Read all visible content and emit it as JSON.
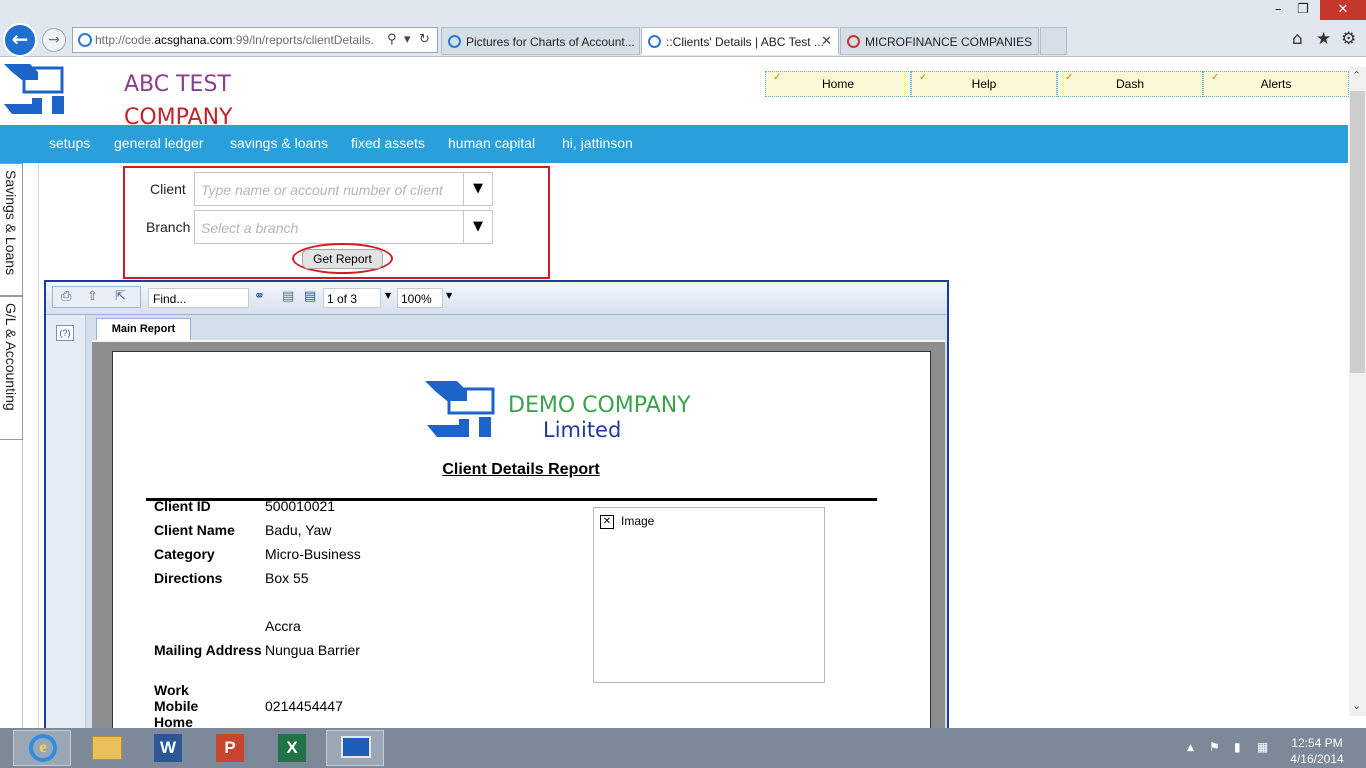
{
  "browser": {
    "address": {
      "prefix": "http://code.",
      "host": "acsghana.com",
      "rest": ":99/ln/reports/clientDetails."
    },
    "tabs": [
      {
        "label": "Pictures for Charts of Account..."
      },
      {
        "label": "::Clients' Details | ABC Test ..."
      },
      {
        "label": "MICROFINANCE COMPANIES"
      }
    ]
  },
  "header": {
    "company_line1": "ABC TEST",
    "company_line2": "COMPANY"
  },
  "topnav": [
    {
      "label": "Home"
    },
    {
      "label": "Help"
    },
    {
      "label": "Dash"
    },
    {
      "label": "Alerts"
    }
  ],
  "menu": [
    {
      "label": "setups"
    },
    {
      "label": "general ledger"
    },
    {
      "label": "savings & loans"
    },
    {
      "label": "fixed assets"
    },
    {
      "label": "human capital"
    },
    {
      "label": "hi, jattinson"
    }
  ],
  "side_tabs": [
    {
      "label": "Savings & Loans"
    },
    {
      "label": "G/L & Accounting"
    }
  ],
  "filter": {
    "client_label": "Client",
    "client_placeholder": "Type name or account number of client",
    "branch_label": "Branch",
    "branch_placeholder": "Select a branch",
    "button_label": "Get Report"
  },
  "viewer": {
    "find_placeholder": "Find...",
    "page_indicator": "1 of 3",
    "zoom": "100%",
    "tab_label": "Main Report",
    "help_label": "(?)"
  },
  "report": {
    "company_name": "DEMO COMPANY",
    "company_suffix": "Limited",
    "title": "Client Details Report",
    "image_caption": "Image",
    "fields": {
      "client_id": {
        "label": "Client ID",
        "value": "500010021"
      },
      "client_name": {
        "label": "Client Name",
        "value": "Badu, Yaw"
      },
      "category": {
        "label": "Category",
        "value": "Micro-Business"
      },
      "directions": {
        "label": "Directions",
        "value": "Box 55",
        "value2": "Accra"
      },
      "mailing": {
        "label": "Mailing Address",
        "value": "Nungua Barrier"
      },
      "work": {
        "label": "Work"
      },
      "mobile": {
        "label": "Mobile",
        "value": "0214454447"
      },
      "home": {
        "label": "Home"
      }
    }
  },
  "taskbar": {
    "time": "12:54 PM",
    "date": "4/16/2014"
  },
  "colors": {
    "menu_bar": "#29a0d9",
    "company_line1": "#8b3d8e",
    "company_line2": "#c0232c",
    "highlight_red": "#d21d23",
    "viewer_border": "#1b3ba3"
  },
  "icons": [
    "back-icon",
    "forward-icon",
    "search-icon",
    "refresh-icon",
    "home-icon",
    "star-icon",
    "gear-icon",
    "print-icon",
    "export-icon",
    "binoculars-icon",
    "page-icon",
    "help-icon",
    "broken-image-icon"
  ]
}
